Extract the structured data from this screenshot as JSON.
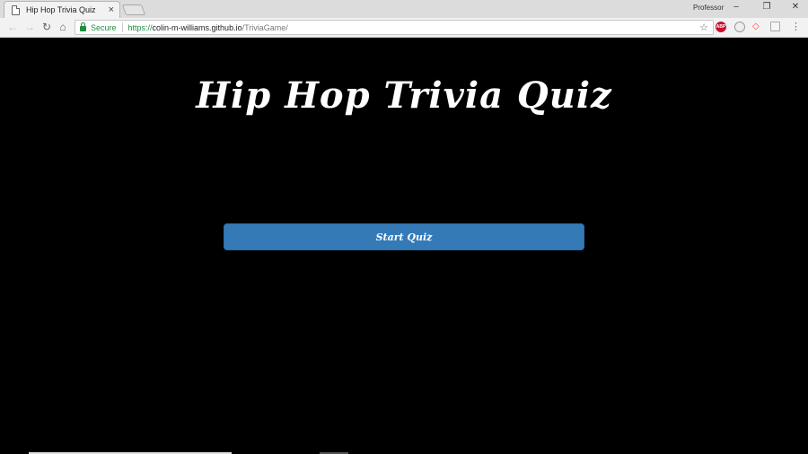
{
  "browser": {
    "tab": {
      "title": "Hip Hop Trivia Quiz",
      "close": "×"
    },
    "profile": "Professor",
    "window_controls": {
      "minimize": "–",
      "maximize": "❐",
      "close": "✕"
    },
    "nav": {
      "back": "←",
      "forward": "→",
      "reload": "↻",
      "home": "⌂"
    },
    "omnibox": {
      "secure_label": "Secure",
      "url_scheme": "https://",
      "url_host": "colin-m-williams.github.io",
      "url_path": "/TriviaGame/",
      "bookmark_icon": "☆"
    },
    "extensions": [
      {
        "name": "adblock-icon",
        "label": "ABP"
      },
      {
        "name": "extension-icon"
      },
      {
        "name": "extension-icon"
      },
      {
        "name": "extension-icon"
      }
    ],
    "menu_icon": "⋮"
  },
  "page": {
    "title": "Hip Hop Trivia Quiz",
    "start_button": "Start Quiz",
    "background": "#000000",
    "button_color": "#337ab7"
  }
}
